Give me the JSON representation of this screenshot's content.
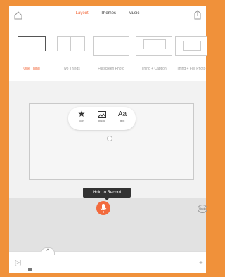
{
  "tabs": [
    {
      "label": "Layout"
    },
    {
      "label": "Themes"
    },
    {
      "label": "Music"
    }
  ],
  "layouts": [
    {
      "label": "One Thing"
    },
    {
      "label": "Two Things"
    },
    {
      "label": "Fullscreen Photo"
    },
    {
      "label": "Thing + Caption"
    },
    {
      "label": "Thing + Full Photo"
    }
  ],
  "popover": {
    "icon_label": "icon",
    "photo_label": "photo",
    "text_label": "text",
    "text_glyph": "Aa"
  },
  "record": {
    "tooltip": "Hold to Record",
    "undo": "Undo"
  },
  "icons": {
    "home": "home-icon",
    "share": "share-icon",
    "star": "star-icon",
    "photo": "photo-icon",
    "mic": "microphone-icon",
    "add": "plus-icon",
    "reorder": "reorder-icon"
  },
  "colors": {
    "accent": "#f26a3d",
    "frame_border": "#f0913a"
  }
}
